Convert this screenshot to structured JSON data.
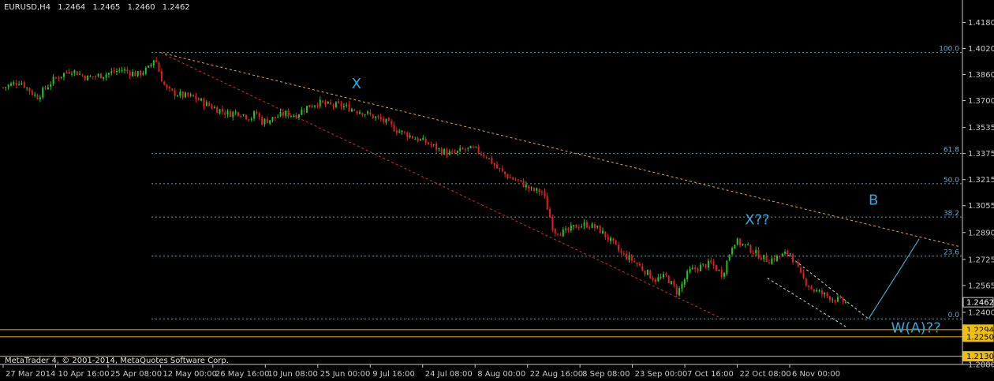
{
  "header": {
    "symbol": "EURUSD,H4",
    "ohlc": [
      "1.2464",
      "1.2465",
      "1.2460",
      "1.2462"
    ]
  },
  "footer": {
    "copyright": "MetaTrader 4, © 2001-2014, MetaQuotes Software Corp."
  },
  "colors": {
    "background": "#000000",
    "bull_candle": "#22c522",
    "bear_candle": "#e02020",
    "grid": "#2f4f4f",
    "fib": "#5f9ea0",
    "upper_trend": "#e6a050",
    "lower_trend": "#d03030",
    "support": "#f0c000",
    "wave_label": "#2fa8e0",
    "projection": "#40c8e8"
  },
  "chart_data": {
    "type": "candlestick",
    "instrument": "EURUSD",
    "timeframe": "H4",
    "ylim": [
      1.208,
      1.425
    ],
    "y_ticks": [
      "1.4180",
      "1.4020",
      "1.3860",
      "1.3700",
      "1.3535",
      "1.3375",
      "1.3215",
      "1.3055",
      "1.2890",
      "1.2725",
      "1.2565",
      "1.2400",
      "1.2080"
    ],
    "price_tags": [
      {
        "label": "1.2462",
        "value": 1.2462,
        "style": "current"
      },
      {
        "label": "1.2294",
        "value": 1.2294,
        "style": "support"
      },
      {
        "label": "1.2250",
        "value": 1.225,
        "style": "support"
      },
      {
        "label": "1.2130",
        "value": 1.213,
        "style": "support"
      }
    ],
    "x_labels": [
      "27 Mar 2014",
      "10 Apr 16:00",
      "25 Apr 08:00",
      "12 May 00:00",
      "26 May 16:00",
      "10 Jun 08:00",
      "25 Jun 00:00",
      "9 Jul 16:00",
      "24 Jul 08:00",
      "8 Aug 00:00",
      "22 Aug 16:00",
      "8 Sep 08:00",
      "23 Sep 00:00",
      "7 Oct 16:00",
      "22 Oct 08:00",
      "6 Nov 00:00"
    ],
    "close_path": [
      [
        0,
        1.378
      ],
      [
        3,
        1.382
      ],
      [
        6,
        1.372
      ],
      [
        9,
        1.383
      ],
      [
        12,
        1.389
      ],
      [
        15,
        1.384
      ],
      [
        18,
        1.386
      ],
      [
        21,
        1.389
      ],
      [
        24,
        1.386
      ],
      [
        26,
        1.39
      ],
      [
        27,
        1.397
      ],
      [
        28,
        1.385
      ],
      [
        29,
        1.377
      ],
      [
        30,
        1.375
      ],
      [
        32,
        1.373
      ],
      [
        34,
        1.372
      ],
      [
        36,
        1.368
      ],
      [
        38,
        1.365
      ],
      [
        40,
        1.362
      ],
      [
        42,
        1.363
      ],
      [
        44,
        1.359
      ],
      [
        45,
        1.363
      ],
      [
        46,
        1.357
      ],
      [
        48,
        1.359
      ],
      [
        50,
        1.362
      ],
      [
        52,
        1.361
      ],
      [
        54,
        1.366
      ],
      [
        56,
        1.369
      ],
      [
        58,
        1.367
      ],
      [
        60,
        1.367
      ],
      [
        62,
        1.365
      ],
      [
        64,
        1.363
      ],
      [
        66,
        1.36
      ],
      [
        68,
        1.357
      ],
      [
        70,
        1.352
      ],
      [
        72,
        1.349
      ],
      [
        74,
        1.346
      ],
      [
        76,
        1.343
      ],
      [
        78,
        1.339
      ],
      [
        80,
        1.337
      ],
      [
        82,
        1.34
      ],
      [
        84,
        1.34
      ],
      [
        86,
        1.336
      ],
      [
        88,
        1.328
      ],
      [
        90,
        1.323
      ],
      [
        92,
        1.32
      ],
      [
        94,
        1.315
      ],
      [
        96,
        1.314
      ],
      [
        98,
        1.29
      ],
      [
        100,
        1.289
      ],
      [
        102,
        1.293
      ],
      [
        104,
        1.294
      ],
      [
        106,
        1.291
      ],
      [
        108,
        1.284
      ],
      [
        110,
        1.276
      ],
      [
        112,
        1.272
      ],
      [
        114,
        1.266
      ],
      [
        116,
        1.26
      ],
      [
        118,
        1.262
      ],
      [
        120,
        1.252
      ],
      [
        122,
        1.265
      ],
      [
        124,
        1.268
      ],
      [
        126,
        1.27
      ],
      [
        128,
        1.263
      ],
      [
        130,
        1.284
      ],
      [
        132,
        1.281
      ],
      [
        134,
        1.276
      ],
      [
        136,
        1.272
      ],
      [
        138,
        1.274
      ],
      [
        140,
        1.277
      ],
      [
        142,
        1.262
      ],
      [
        144,
        1.254
      ],
      [
        146,
        1.251
      ],
      [
        148,
        1.248
      ],
      [
        150,
        1.246
      ]
    ],
    "fib_levels": [
      {
        "label": "100.0",
        "value": 1.3995
      },
      {
        "label": "61.8",
        "value": 1.3375
      },
      {
        "label": "50.0",
        "value": 1.319
      },
      {
        "label": "38.2",
        "value": 1.2985
      },
      {
        "label": "23.6",
        "value": 1.2745
      },
      {
        "label": "0.0",
        "value": 1.236
      }
    ],
    "wave_labels": [
      {
        "text": "X",
        "x": 62,
        "y": 1.3775
      },
      {
        "text": "X??",
        "x": 132,
        "y": 1.294
      },
      {
        "text": "B",
        "x": 154,
        "y": 1.306
      },
      {
        "text": "W(A)??",
        "x": 158,
        "y": 1.2275
      }
    ],
    "trend_lines": [
      {
        "name": "upper",
        "from": [
          28,
          1.3995
        ],
        "to": [
          170,
          1.2805
        ]
      },
      {
        "name": "lower",
        "from": [
          28,
          1.3995
        ],
        "to": [
          128,
          1.236
        ]
      },
      {
        "name": "wedge-top",
        "from": [
          139,
          1.277
        ],
        "to": [
          154,
          1.236
        ]
      },
      {
        "name": "wedge-bottom",
        "from": [
          136,
          1.261
        ],
        "to": [
          150,
          1.231
        ]
      }
    ],
    "projection": {
      "from": [
        154,
        1.236
      ],
      "to": [
        163,
        1.285
      ]
    },
    "support_levels": [
      1.2294,
      1.225,
      1.213
    ]
  }
}
